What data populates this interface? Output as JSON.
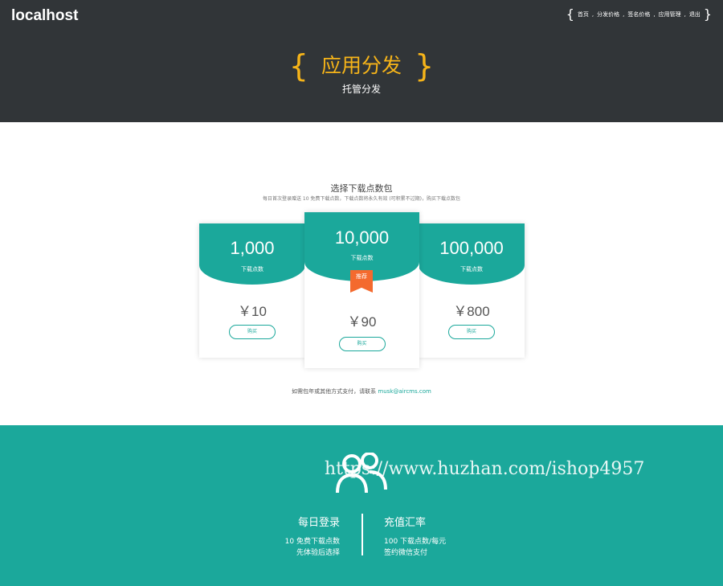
{
  "header": {
    "brand": "localhost",
    "nav": [
      "首页",
      "分发价格",
      "签名价格",
      "应用管理",
      "退出"
    ],
    "hero_title": "应用分发",
    "hero_subtitle": "托管分发",
    "brace_open": "{",
    "brace_close": "}"
  },
  "pricing": {
    "title": "选择下载点数包",
    "subtitle": "每日首次登录赠送 10 免费下载点数，下载点数将永久有效 (可积累不过期)，购买下载点数包",
    "cards": [
      {
        "amount": "1,000",
        "label": "下载点数",
        "price": "￥10",
        "button": "购买"
      },
      {
        "amount": "10,000",
        "label": "下载点数",
        "price": "￥90",
        "button": "购买",
        "badge": "推荐"
      },
      {
        "amount": "100,000",
        "label": "下载点数",
        "price": "￥800",
        "button": "购买"
      }
    ],
    "contact_text": "如需包年或其他方式支付，请联系",
    "contact_email": "musk@aircms.com"
  },
  "footer": {
    "watermark": "https://www.huzhan.com/ishop4957",
    "left": {
      "title": "每日登录",
      "line1": "10 免费下载点数",
      "line2": "先体验后选择"
    },
    "right": {
      "title": "充值汇率",
      "line1": "100 下载点数/每元",
      "line2": "签约微信支付"
    }
  },
  "colors": {
    "header_bg": "#313538",
    "accent": "#f6b419",
    "teal": "#1ba89b",
    "badge": "#f46a2e"
  },
  "icons": {
    "footer": "users-icon"
  }
}
